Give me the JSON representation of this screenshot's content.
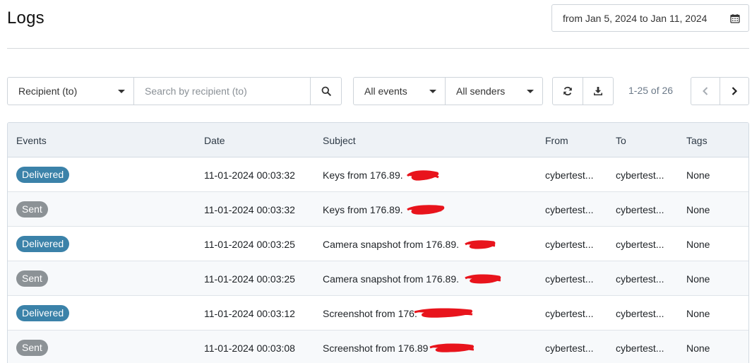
{
  "header": {
    "title": "Logs",
    "date_range": "from Jan 5, 2024 to Jan 11, 2024"
  },
  "toolbar": {
    "recipient_select": "Recipient (to)",
    "search_placeholder": "Search by recipient (to)",
    "events_select": "All events",
    "senders_select": "All senders",
    "pagination": "1-25 of 26"
  },
  "table": {
    "columns": [
      "Events",
      "Date",
      "Subject",
      "From",
      "To",
      "Tags"
    ],
    "rows": [
      {
        "event": "Delivered",
        "date": "11-01-2024 00:03:32",
        "subject": "Keys from 176.89.",
        "from": "cybertest...",
        "to": "cybertest...",
        "tags": "None"
      },
      {
        "event": "Sent",
        "date": "11-01-2024 00:03:32",
        "subject": "Keys from 176.89.",
        "from": "cybertest...",
        "to": "cybertest...",
        "tags": "None"
      },
      {
        "event": "Delivered",
        "date": "11-01-2024 00:03:25",
        "subject": "Camera snapshot from 176.89.",
        "from": "cybertest...",
        "to": "cybertest...",
        "tags": "None"
      },
      {
        "event": "Sent",
        "date": "11-01-2024 00:03:25",
        "subject": "Camera snapshot from 176.89.",
        "from": "cybertest...",
        "to": "cybertest...",
        "tags": "None"
      },
      {
        "event": "Delivered",
        "date": "11-01-2024 00:03:12",
        "subject": "Screenshot from 176.",
        "from": "cybertest...",
        "to": "cybertest...",
        "tags": "None"
      },
      {
        "event": "Sent",
        "date": "11-01-2024 00:03:08",
        "subject": "Screenshot from 176.89",
        "from": "cybertest...",
        "to": "cybertest...",
        "tags": "None"
      }
    ]
  },
  "colors": {
    "delivered_badge": "#3b82a9",
    "sent_badge": "#8c9296",
    "redaction": "#e8141c"
  },
  "icons": {
    "date_range": "calendar-icon",
    "search": "search-icon",
    "refresh": "refresh-icon",
    "download": "download-icon",
    "prev": "chevron-left-icon",
    "next": "chevron-right-icon"
  }
}
